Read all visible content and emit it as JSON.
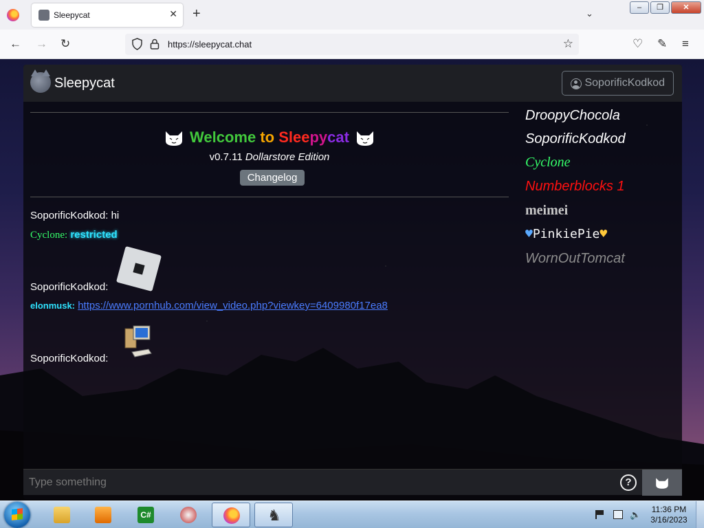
{
  "browser": {
    "tab_title": "Sleepycat",
    "tab_close": "✕",
    "new_tab": "+",
    "url": "https://sleepycat.chat",
    "window_buttons": {
      "minimize": "–",
      "maximize": "❐",
      "close": "✕"
    }
  },
  "app": {
    "brand": "Sleepycat",
    "current_user": "SoporificKodkod",
    "welcome": {
      "prefix": "Welcome",
      "to": "to",
      "sleepy_part1": "Slee",
      "sleepy_part2": "py",
      "sleepy_part3": "cat"
    },
    "version": "v0.7.11",
    "edition": "Dollarstore Edition",
    "changelog_label": "Changelog",
    "messages": [
      {
        "user": "SoporificKodkod:",
        "text": "hi"
      },
      {
        "user": "Cyclone:",
        "text": "restricted"
      },
      {
        "user": "SoporificKodkod:",
        "text": ""
      },
      {
        "user": "elonmusk:",
        "text": "https://www.pornhub.com/view_video.php?viewkey=6409980f17ea8"
      },
      {
        "user": "SoporificKodkod:",
        "text": ""
      }
    ],
    "online_users": [
      {
        "name": "DroopyChocola",
        "color": "#ffffff"
      },
      {
        "name": "SoporificKodkod",
        "color": "#ffffff"
      },
      {
        "name": "Cyclone",
        "color": "#35ff6a"
      },
      {
        "name": "Numberblocks 1",
        "color": "#ff1010"
      },
      {
        "name": "meimei",
        "color": "#c8c8c8"
      },
      {
        "name": "PinkiePie",
        "color": "#f8f8f8"
      },
      {
        "name": "WornOutTomcat",
        "color": "#8c8c8c"
      }
    ],
    "input": {
      "placeholder": "Type something",
      "value": ""
    },
    "help_label": "?"
  },
  "taskbar": {
    "time": "11:36 PM",
    "date": "3/16/2023"
  }
}
